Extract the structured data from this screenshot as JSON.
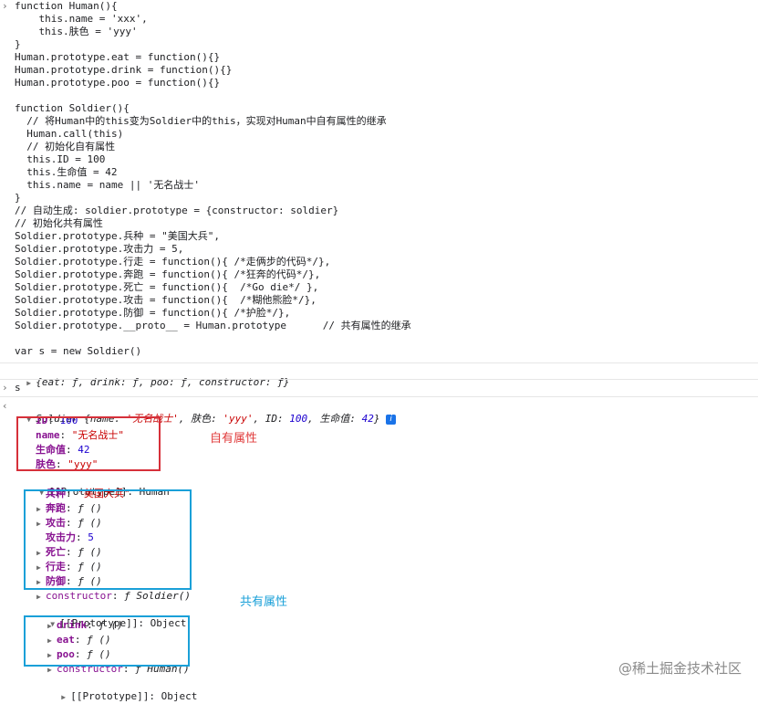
{
  "code_lines": [
    "function Human(){",
    "    this.name = 'xxx',",
    "    this.肤色 = 'yyy'",
    "}",
    "Human.prototype.eat = function(){}",
    "Human.prototype.drink = function(){}",
    "Human.prototype.poo = function(){}",
    "",
    "function Soldier(){",
    "  // 将Human中的this变为Soldier中的this，实现对Human中自有属性的继承",
    "  Human.call(this)",
    "  // 初始化自有属性",
    "  this.ID = 100",
    "  this.生命值 = 42",
    "  this.name = name || '无名战士'",
    "}",
    "// 自动生成: soldier.prototype = {constructor: soldier}",
    "// 初始化共有属性",
    "Soldier.prototype.兵种 = \"美国大兵\",",
    "Soldier.prototype.攻击力 = 5,",
    "Soldier.prototype.行走 = function(){ /*走俩步的代码*/},",
    "Soldier.prototype.奔跑 = function(){ /*狂奔的代码*/},",
    "Soldier.prototype.死亡 = function(){  /*Go die*/ },",
    "Soldier.prototype.攻击 = function(){  /*糊他熊脸*/},",
    "Soldier.prototype.防御 = function(){ /*护脸*/},",
    "Soldier.prototype.__proto__ = Human.prototype      // 共有属性的继承",
    "",
    "var s = new Soldier()"
  ],
  "result1": "{eat: ƒ, drink: ƒ, poo: ƒ, constructor: ƒ}",
  "input2": "s",
  "soldier_summary": {
    "prefix": "Soldier {name: ",
    "name_val": "'无名战士'",
    "mid1": ", 肤色: ",
    "skin_val": "'yyy'",
    "mid2": ", ID: ",
    "id_val": "100",
    "mid3": ", 生命值: ",
    "hp_val": "42",
    "suffix": "}"
  },
  "own_props": [
    {
      "key": "ID",
      "sep": ": ",
      "val": "100"
    },
    {
      "key": "name",
      "sep": ": ",
      "val": "\"无名战士\""
    },
    {
      "key": "生命值",
      "sep": ": ",
      "val": "42"
    },
    {
      "key": "肤色",
      "sep": ": ",
      "val": "\"yyy\""
    }
  ],
  "proto1_label": "[[Prototype]]: Human",
  "proto1_items": [
    {
      "key": "兵种",
      "val": "\"美国大兵\""
    },
    {
      "key": "奔跑",
      "val": "ƒ ()"
    },
    {
      "key": "攻击",
      "val": "ƒ ()"
    },
    {
      "key": "攻击力",
      "val": "5"
    },
    {
      "key": "死亡",
      "val": "ƒ ()"
    },
    {
      "key": "行走",
      "val": "ƒ ()"
    },
    {
      "key": "防御",
      "val": "ƒ ()"
    },
    {
      "key": "constructor",
      "val": "ƒ Soldier()"
    }
  ],
  "proto2_label": "[[Prototype]]: Object",
  "proto2_items": [
    {
      "key": "drink",
      "val": "ƒ ()"
    },
    {
      "key": "eat",
      "val": "ƒ ()"
    },
    {
      "key": "poo",
      "val": "ƒ ()"
    },
    {
      "key": "constructor",
      "val": "ƒ Human()"
    }
  ],
  "proto3_label": "[[Prototype]]: Object",
  "annot_own": "自有属性",
  "annot_shared": "共有属性",
  "watermark": "@稀土掘金技术社区",
  "colors": {
    "red_box": "#d6303a",
    "blue_box": "#1aa0d8"
  }
}
